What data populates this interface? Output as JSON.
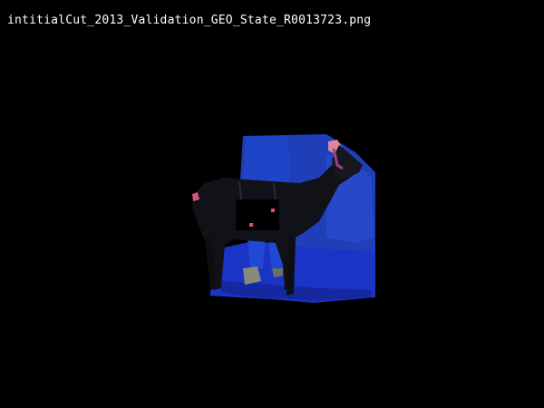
{
  "window": {
    "title": "intitialCut_2013_Validation_GEO_State_R0013723.png"
  },
  "image": {
    "subject": "goat-photo",
    "colors": {
      "background": "#000000",
      "backdrop": "#1f3fb8",
      "floor_tarp": "#1a34c6",
      "goat_body": "#111118",
      "mask_patch": "#000000",
      "marker_pink": "#e04c7a",
      "handler_clothing": "#1e44c8"
    }
  }
}
